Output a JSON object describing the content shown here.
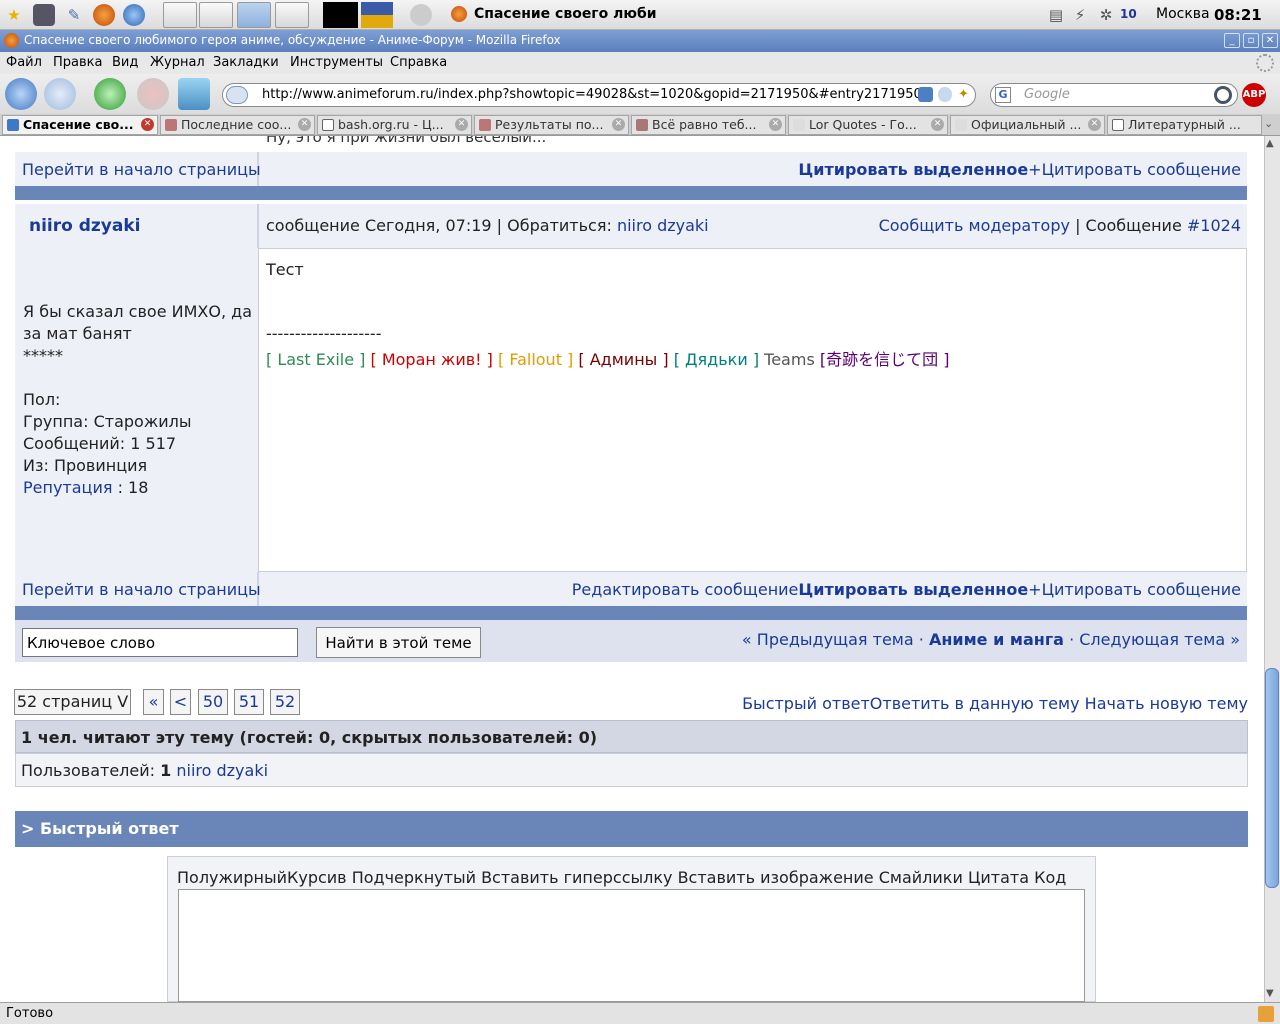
{
  "taskbar": {
    "window_title": "Спасение своего люби",
    "city": "Москва",
    "time": "08:21",
    "badge": "10"
  },
  "window": {
    "title": "Спасение своего любимого героя аниме, обсуждение - Аниме-Форум - Mozilla Firefox"
  },
  "menu": [
    "Файл",
    "Правка",
    "Вид",
    "Журнал",
    "Закладки",
    "Инструменты",
    "Справка"
  ],
  "nav": {
    "url": "http://www.animeforum.ru/index.php?showtopic=49028&st=1020&gopid=2171950&#entry2171950",
    "search_placeholder": "Google",
    "abp": "ABP"
  },
  "tabs": [
    "Спасение сво...",
    "Последние соо...",
    "bash.org.ru - Ц...",
    "Результаты по...",
    "Всё равно теб...",
    "Lor Quotes - Го...",
    "Официальный ...",
    "Литературный ..."
  ],
  "page": {
    "prev_post_partial": "Ну, это я при жизни был весёлый...",
    "top_link": "Перейти в начало страницы",
    "quote_selected": "Цитировать выделенное",
    "quote_plus": "+",
    "quote_message": "Цитировать сообщение",
    "post": {
      "author": "niiro dzyaki",
      "header_prefix": "сообщение Сегодня, 07:19 | Обратиться:",
      "header_name": "niiro dzyaki",
      "report": "Сообщить модератору",
      "sep": "|",
      "message_label": "Сообщение",
      "message_number": "#1024",
      "body": "Тест",
      "sig_line": "--------------------",
      "signature": [
        {
          "text": "[ Last Exile ]",
          "color": "#2e8b57"
        },
        {
          "text": "[ Моран жив! ]",
          "color": "#cc0000"
        },
        {
          "text": "[ Fallout ]",
          "color": "#e69a00"
        },
        {
          "text": "[ Админы ]",
          "color": "#7a0000"
        },
        {
          "text": "[ Дядьки ]",
          "color": "#007f7f"
        },
        {
          "text": "Teams",
          "color": "#555555"
        },
        {
          "text": "[奇跡を信じて団 ]",
          "color": "#5b0070"
        }
      ],
      "user_title": "Я бы сказал свое ИМХО, да за мат банят",
      "stars": "*****",
      "gender": "Пол:",
      "group": "Группа: Старожилы",
      "posts": "Сообщений: 1 517",
      "from": "Из: Провинция",
      "reputation_label": "Репутация",
      "reputation_value": ": 18",
      "edit": "Редактировать сообщение"
    },
    "search": {
      "keyword_value": "Ключевое слово",
      "button": "Найти в этой теме"
    },
    "topic_nav": {
      "prev": "« Предыдущая тема",
      "dot": "·",
      "forum": "Аниме и манга",
      "next": "Следующая тема »"
    },
    "pagination": {
      "pages_label": "52 страниц V",
      "first": "«",
      "prev": "<",
      "pages": [
        "50",
        "51",
        "52"
      ]
    },
    "actions": {
      "quick_reply": "Быстрый ответ",
      "reply": "Ответить в данную тему",
      "new_topic": "Начать новую тему"
    },
    "readers": {
      "heading": "1 чел. читают эту тему (гостей: 0, скрытых пользователей: 0)",
      "users_label": "Пользователей:",
      "users_count": "1",
      "user_name": "niiro dzyaki"
    },
    "quick_reply": {
      "heading": "> Быстрый ответ",
      "toolbar": [
        "Полужирный",
        "Курсив",
        "Подчеркнутый",
        "Вставить гиперссылку",
        "Вставить изображение",
        "Смайлики",
        "Цитата",
        "Код"
      ]
    }
  },
  "status": {
    "text": "Готово"
  }
}
